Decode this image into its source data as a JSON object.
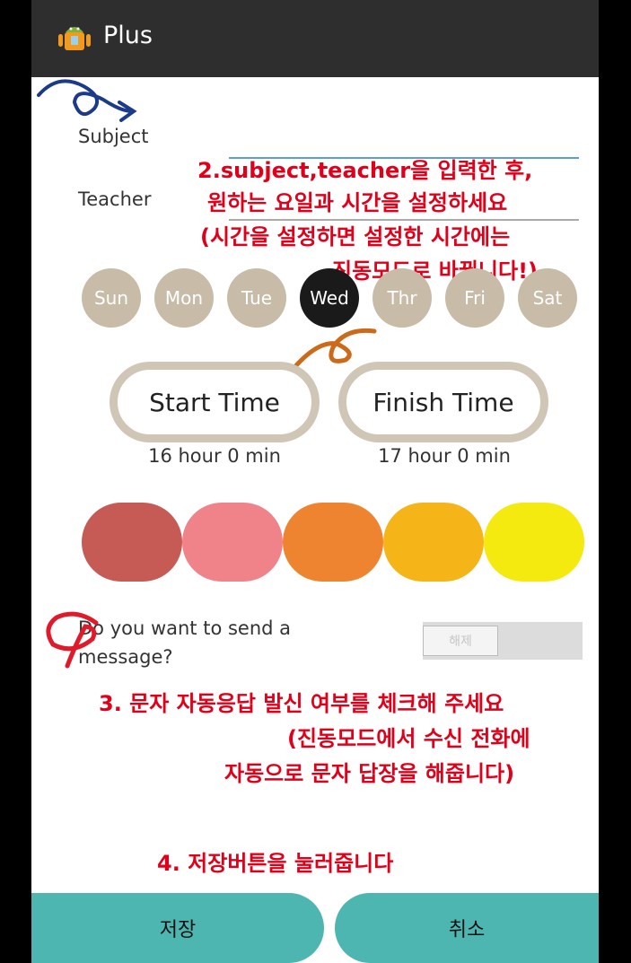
{
  "app": {
    "title": "Plus"
  },
  "form": {
    "subject_label": "Subject",
    "teacher_label": "Teacher",
    "subject_value": "",
    "teacher_value": ""
  },
  "days": [
    {
      "label": "Sun",
      "selected": false
    },
    {
      "label": "Mon",
      "selected": false
    },
    {
      "label": "Tue",
      "selected": false
    },
    {
      "label": "Wed",
      "selected": true
    },
    {
      "label": "Thr",
      "selected": false
    },
    {
      "label": "Fri",
      "selected": false
    },
    {
      "label": "Sat",
      "selected": false
    }
  ],
  "time": {
    "start_label": "Start Time",
    "finish_label": "Finish Time",
    "start_value": "16 hour 0 min",
    "finish_value": "17 hour 0 min"
  },
  "colors": [
    "#c65a54",
    "#f0828a",
    "#ee8430",
    "#f5b518",
    "#f4ea10"
  ],
  "message": {
    "question_line1": "Do you want to send a",
    "question_line2": "message?",
    "toggle_label": "해제",
    "toggle_on": false
  },
  "annotations": {
    "step2_line1": "2.subject,teacher을 입력한 후,",
    "step2_line2": "원하는 요일과 시간을 설정하세요",
    "step2_line3": "(시간을 설정하면 설정한 시간에는",
    "step2_line4": "진동모드로 바뀝니다!)",
    "step3_line1": "3. 문자 자동응답 발신 여부를 체크해 주세요",
    "step3_line2": "(진동모드에서 수신 전화에",
    "step3_line3": "자동으로 문자 답장을 해줍니다)",
    "step4": "4. 저장버튼을 눌러줍니다"
  },
  "buttons": {
    "save": "저장",
    "cancel": "취소"
  },
  "theme": {
    "actionbar": "#2e2e2e",
    "day_inactive": "#c8bca8",
    "day_active": "#1a1a1a",
    "annotation": "#e0001a",
    "button": "#4db6b0"
  }
}
